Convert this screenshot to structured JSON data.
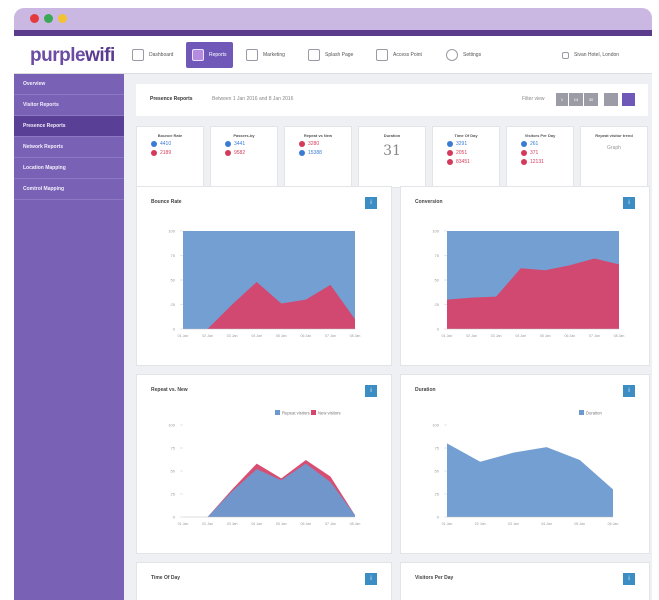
{
  "app": {
    "logo_light": "purple",
    "logo_bold": "wifi"
  },
  "nav": [
    {
      "label": "Dashboard",
      "icon": "home-icon"
    },
    {
      "label": "Reports",
      "icon": "pie-chart-icon"
    },
    {
      "label": "Marketing",
      "icon": "megaphone-icon"
    },
    {
      "label": "Splash Page",
      "icon": "splash-page-icon"
    },
    {
      "label": "Access Point",
      "icon": "access-point-icon"
    },
    {
      "label": "Settings",
      "icon": "gear-icon"
    }
  ],
  "user": {
    "label": "Sivan Hotel, London"
  },
  "sidebar": [
    {
      "label": "Overview"
    },
    {
      "label": "Visitor Reports"
    },
    {
      "label": "Presence Reports"
    },
    {
      "label": "Network Reports"
    },
    {
      "label": "Location Mapping"
    },
    {
      "label": "Comtrol Mapping"
    }
  ],
  "topbar": {
    "title": "Presence Reports",
    "subtitle": "Between 1 Jan 2016 and 8 Jan 2016",
    "filter_label": "Filter view",
    "filter_buttons": [
      "1",
      "14",
      "30"
    ]
  },
  "kpis": [
    {
      "label": "Bounce Rate",
      "row1": "4410",
      "row2": "2189"
    },
    {
      "label": "Passers-by",
      "row1": "3441",
      "row2": "9582"
    },
    {
      "label": "Repeat vs New",
      "row1": "3280",
      "row2": "15388"
    },
    {
      "label": "Duration",
      "big": "31"
    },
    {
      "label": "Time Of Day",
      "row1": "3291",
      "row2": "2051",
      "row3": "83451"
    },
    {
      "label": "Visitors Per Day",
      "row1": "261",
      "row2": "371",
      "row3": "12131"
    },
    {
      "label": "Repeat visitor trend",
      "small": "Graph"
    }
  ],
  "cards": {
    "bounce": {
      "title": "Bounce Rate"
    },
    "conversion": {
      "title": "Conversion"
    },
    "repeat": {
      "title": "Repeat vs. New",
      "legend": [
        "Repeat visitors",
        "New visitors"
      ]
    },
    "duration": {
      "title": "Duration",
      "legend": [
        "Duration"
      ]
    },
    "tod": {
      "title": "Time Of Day"
    },
    "vpd": {
      "title": "Visitors Per Day"
    }
  },
  "colors": {
    "blue": "#6c9ad0",
    "red": "#d6456b",
    "purple": "#7962b5"
  },
  "chart_data": [
    {
      "type": "area",
      "title": "Bounce Rate",
      "x": [
        "01 Jan",
        "02 Jan",
        "03 Jan",
        "04 Jan",
        "05 Jan",
        "06 Jan",
        "07 Jan",
        "08 Jan"
      ],
      "ylim": [
        0,
        100
      ],
      "yticks": [
        0,
        25,
        50,
        75,
        100
      ],
      "series": [
        {
          "values": [
            100,
            100,
            100,
            100,
            100,
            100,
            100,
            100
          ]
        },
        {
          "values": [
            0,
            0,
            25,
            48,
            26,
            30,
            45,
            10
          ]
        }
      ]
    },
    {
      "type": "area",
      "title": "Conversion",
      "x": [
        "01 Jan",
        "02 Jan",
        "03 Jan",
        "04 Jan",
        "05 Jan",
        "06 Jan",
        "07 Jan",
        "08 Jan"
      ],
      "ylim": [
        0,
        100
      ],
      "yticks": [
        0,
        25,
        50,
        75,
        100
      ],
      "series": [
        {
          "values": [
            100,
            100,
            100,
            100,
            100,
            100,
            100,
            100
          ]
        },
        {
          "values": [
            30,
            32,
            33,
            62,
            60,
            65,
            72,
            66
          ]
        }
      ]
    },
    {
      "type": "area",
      "title": "Repeat vs. New",
      "x": [
        "01 Jan",
        "02 Jan",
        "03 Jan",
        "04 Jan",
        "05 Jan",
        "06 Jan",
        "07 Jan",
        "08 Jan"
      ],
      "ylim": [
        0,
        100
      ],
      "yticks": [
        0,
        25,
        50,
        75,
        100
      ],
      "series": [
        {
          "name": "Repeat visitors",
          "values": [
            0,
            0,
            28,
            52,
            40,
            58,
            38,
            2
          ]
        },
        {
          "name": "New visitors",
          "values": [
            0,
            0,
            30,
            58,
            42,
            62,
            44,
            2
          ]
        }
      ]
    },
    {
      "type": "area",
      "title": "Duration",
      "x": [
        "01 Jan",
        "02 Jan",
        "03 Jan",
        "04 Jan",
        "05 Jan",
        "06 Jan"
      ],
      "ylim": [
        0,
        100
      ],
      "yticks": [
        0,
        25,
        50,
        75,
        100
      ],
      "series": [
        {
          "name": "Duration",
          "values": [
            80,
            60,
            70,
            76,
            62,
            30
          ]
        }
      ]
    }
  ]
}
